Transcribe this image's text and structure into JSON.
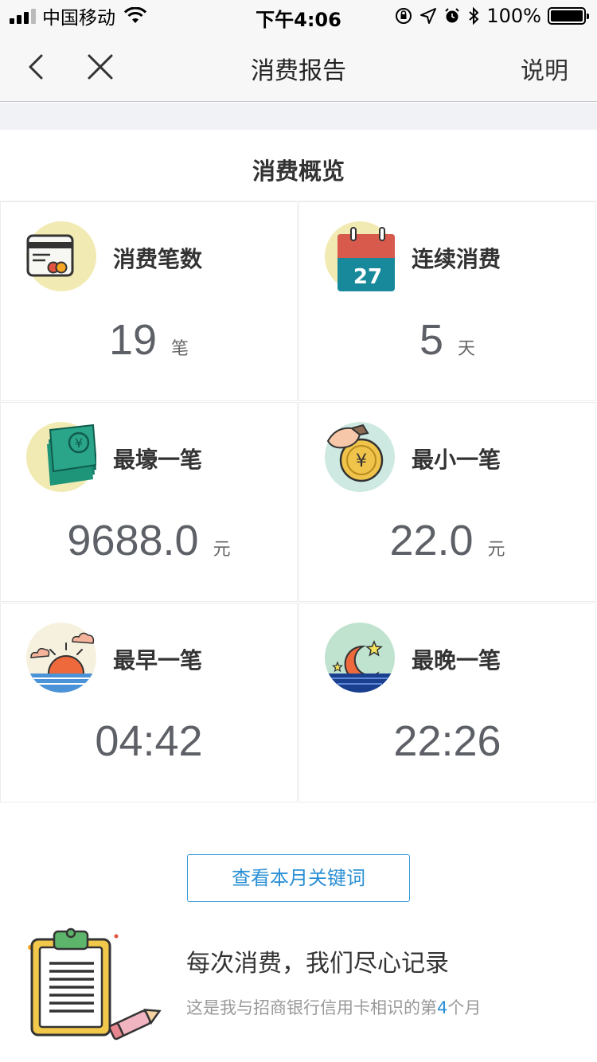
{
  "status_bar": {
    "carrier": "中国移动",
    "time": "下午4:06",
    "battery": "100%"
  },
  "nav": {
    "title": "消费报告",
    "help": "说明"
  },
  "section_title": "消费概览",
  "stats": [
    {
      "label": "消费笔数",
      "value": "19",
      "unit": "笔",
      "icon": "credit-card-icon"
    },
    {
      "label": "连续消费",
      "value": "5",
      "unit": "天",
      "icon": "calendar-icon"
    },
    {
      "label": "最壕一笔",
      "value": "9688.0",
      "unit": "元",
      "icon": "money-stack-icon"
    },
    {
      "label": "最小一笔",
      "value": "22.0",
      "unit": "元",
      "icon": "coin-icon"
    },
    {
      "label": "最早一笔",
      "value": "04:42",
      "unit": "",
      "icon": "sunrise-icon"
    },
    {
      "label": "最晚一笔",
      "value": "22:26",
      "unit": "",
      "icon": "moon-icon"
    }
  ],
  "calendar_day": "27",
  "keywords_button": "查看本月关键词",
  "footer": {
    "title": "每次消费，我们尽心记录",
    "text_before": "这是我与招商银行信用卡相识的第",
    "month_count": "4",
    "text_after": "个月"
  },
  "colors": {
    "accent": "#2a8fd4",
    "value_text": "#5d6066"
  }
}
